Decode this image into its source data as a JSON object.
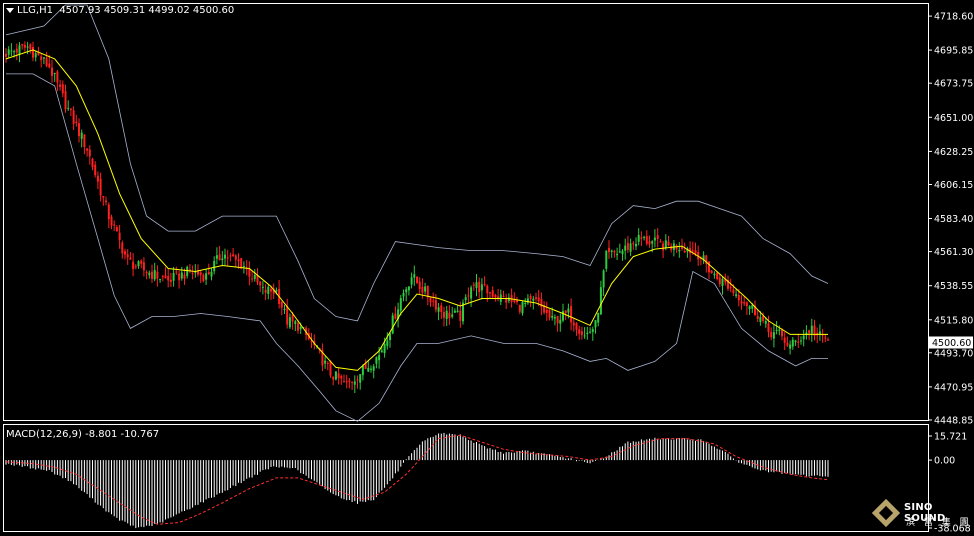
{
  "header": {
    "symbol": "LLG,H1",
    "ohlc": "4507.93 4509.31 4499.02 4500.60"
  },
  "macd": {
    "label": "MACD(12,26,9) -8.801 -10.767",
    "axis_labels": [
      "15.721",
      "0.00",
      "-38.068"
    ]
  },
  "logo": {
    "en": "SINO SOUND",
    "cn": "滨 富 集 團"
  },
  "colors": {
    "background": "#000000",
    "up_candle": "#2ecc40",
    "down_candle": "#ff2020",
    "ma_line": "#ffff00",
    "bands": "#aab4d2",
    "macd_hist": "#ffffff",
    "macd_signal": "#ff3030",
    "grid_border": "#ffffff",
    "price_tag_bg": "#ffffff"
  },
  "chart_data": [
    {
      "type": "candlestick",
      "title": "LLG,H1",
      "y_ticks": [
        4718.6,
        4695.85,
        4673.75,
        4651.0,
        4628.25,
        4606.15,
        4583.4,
        4561.3,
        4538.55,
        4515.8,
        4493.7,
        4470.95,
        4448.85
      ],
      "y_tick_labels": [
        "4718.60",
        "4695.85",
        "4673.75",
        "4651.00",
        "4628.25",
        "4606.15",
        "4583.40",
        "4561.30",
        "4538.55",
        "4515.80",
        "4493.70",
        "4470.95",
        "4448.85"
      ],
      "ylim": [
        4448.85,
        4726
      ],
      "last_price": "4500.60",
      "indicators": [
        "moving-average",
        "bollinger-bands"
      ],
      "close_path": [
        [
          0,
          4694
        ],
        [
          8,
          4698
        ],
        [
          16,
          4685
        ],
        [
          22,
          4660
        ],
        [
          30,
          4630
        ],
        [
          38,
          4585
        ],
        [
          45,
          4555
        ],
        [
          52,
          4548
        ],
        [
          60,
          4542
        ],
        [
          68,
          4548
        ],
        [
          74,
          4545
        ],
        [
          80,
          4560
        ],
        [
          88,
          4552
        ],
        [
          95,
          4535
        ],
        [
          100,
          4535
        ],
        [
          104,
          4515
        ],
        [
          108,
          4512
        ],
        [
          114,
          4498
        ],
        [
          120,
          4480
        ],
        [
          126,
          4472
        ],
        [
          132,
          4482
        ],
        [
          138,
          4492
        ],
        [
          142,
          4510
        ],
        [
          146,
          4530
        ],
        [
          150,
          4545
        ],
        [
          156,
          4532
        ],
        [
          162,
          4520
        ],
        [
          168,
          4518
        ],
        [
          172,
          4540
        ],
        [
          178,
          4535
        ],
        [
          184,
          4530
        ],
        [
          190,
          4525
        ],
        [
          196,
          4528
        ],
        [
          202,
          4515
        ],
        [
          208,
          4520
        ],
        [
          214,
          4505
        ],
        [
          218,
          4512
        ],
        [
          222,
          4558
        ],
        [
          228,
          4562
        ],
        [
          234,
          4570
        ],
        [
          238,
          4568
        ],
        [
          244,
          4565
        ],
        [
          250,
          4565
        ],
        [
          256,
          4560
        ],
        [
          262,
          4545
        ],
        [
          266,
          4540
        ],
        [
          272,
          4530
        ],
        [
          278,
          4520
        ],
        [
          282,
          4508
        ],
        [
          286,
          4506
        ],
        [
          290,
          4498
        ],
        [
          294,
          4504
        ],
        [
          298,
          4510
        ],
        [
          300,
          4505
        ],
        [
          304,
          4503
        ]
      ],
      "ma_path": [
        [
          0,
          4690
        ],
        [
          10,
          4696
        ],
        [
          18,
          4690
        ],
        [
          26,
          4672
        ],
        [
          34,
          4640
        ],
        [
          42,
          4600
        ],
        [
          50,
          4570
        ],
        [
          60,
          4550
        ],
        [
          70,
          4548
        ],
        [
          80,
          4552
        ],
        [
          90,
          4550
        ],
        [
          98,
          4538
        ],
        [
          106,
          4520
        ],
        [
          114,
          4500
        ],
        [
          122,
          4484
        ],
        [
          130,
          4482
        ],
        [
          138,
          4495
        ],
        [
          146,
          4520
        ],
        [
          152,
          4533
        ],
        [
          160,
          4530
        ],
        [
          168,
          4525
        ],
        [
          176,
          4530
        ],
        [
          186,
          4530
        ],
        [
          196,
          4527
        ],
        [
          206,
          4520
        ],
        [
          216,
          4512
        ],
        [
          224,
          4540
        ],
        [
          232,
          4558
        ],
        [
          240,
          4563
        ],
        [
          250,
          4565
        ],
        [
          258,
          4556
        ],
        [
          266,
          4543
        ],
        [
          274,
          4530
        ],
        [
          282,
          4515
        ],
        [
          290,
          4506
        ],
        [
          298,
          4506
        ],
        [
          304,
          4506
        ]
      ],
      "upper_band": [
        [
          0,
          4706
        ],
        [
          14,
          4712
        ],
        [
          22,
          4726
        ],
        [
          30,
          4726
        ],
        [
          38,
          4690
        ],
        [
          46,
          4620
        ],
        [
          52,
          4585
        ],
        [
          60,
          4575
        ],
        [
          70,
          4575
        ],
        [
          80,
          4585
        ],
        [
          90,
          4585
        ],
        [
          100,
          4585
        ],
        [
          108,
          4555
        ],
        [
          114,
          4530
        ],
        [
          122,
          4518
        ],
        [
          130,
          4515
        ],
        [
          136,
          4540
        ],
        [
          144,
          4568
        ],
        [
          152,
          4566
        ],
        [
          160,
          4564
        ],
        [
          172,
          4562
        ],
        [
          184,
          4562
        ],
        [
          196,
          4560
        ],
        [
          206,
          4558
        ],
        [
          216,
          4552
        ],
        [
          224,
          4580
        ],
        [
          232,
          4592
        ],
        [
          240,
          4590
        ],
        [
          248,
          4595
        ],
        [
          256,
          4595
        ],
        [
          264,
          4590
        ],
        [
          272,
          4585
        ],
        [
          280,
          4570
        ],
        [
          290,
          4560
        ],
        [
          298,
          4545
        ],
        [
          304,
          4540
        ]
      ],
      "lower_band": [
        [
          0,
          4680
        ],
        [
          10,
          4680
        ],
        [
          18,
          4672
        ],
        [
          26,
          4620
        ],
        [
          34,
          4570
        ],
        [
          40,
          4532
        ],
        [
          46,
          4510
        ],
        [
          54,
          4518
        ],
        [
          62,
          4518
        ],
        [
          72,
          4520
        ],
        [
          82,
          4518
        ],
        [
          94,
          4515
        ],
        [
          100,
          4500
        ],
        [
          108,
          4485
        ],
        [
          116,
          4468
        ],
        [
          122,
          4455
        ],
        [
          130,
          4448
        ],
        [
          138,
          4460
        ],
        [
          146,
          4485
        ],
        [
          152,
          4500
        ],
        [
          160,
          4500
        ],
        [
          172,
          4505
        ],
        [
          184,
          4500
        ],
        [
          196,
          4500
        ],
        [
          206,
          4495
        ],
        [
          216,
          4488
        ],
        [
          222,
          4490
        ],
        [
          230,
          4482
        ],
        [
          240,
          4488
        ],
        [
          248,
          4500
        ],
        [
          254,
          4548
        ],
        [
          262,
          4540
        ],
        [
          272,
          4510
        ],
        [
          282,
          4495
        ],
        [
          292,
          4485
        ],
        [
          298,
          4490
        ],
        [
          304,
          4490
        ]
      ]
    },
    {
      "type": "macd",
      "title": "MACD(12,26,9)",
      "macd_value": -8.801,
      "signal_value": -10.767,
      "ylim": [
        -38.068,
        15.721
      ],
      "hist_path": [
        [
          0,
          -2
        ],
        [
          8,
          -4
        ],
        [
          16,
          -6
        ],
        [
          24,
          -12
        ],
        [
          32,
          -22
        ],
        [
          40,
          -32
        ],
        [
          48,
          -38
        ],
        [
          56,
          -36
        ],
        [
          64,
          -30
        ],
        [
          72,
          -24
        ],
        [
          80,
          -18
        ],
        [
          90,
          -10
        ],
        [
          98,
          -4
        ],
        [
          106,
          -4
        ],
        [
          114,
          -12
        ],
        [
          122,
          -20
        ],
        [
          130,
          -24
        ],
        [
          136,
          -22
        ],
        [
          142,
          -12
        ],
        [
          148,
          0
        ],
        [
          154,
          10
        ],
        [
          160,
          15
        ],
        [
          168,
          14
        ],
        [
          176,
          8
        ],
        [
          184,
          4
        ],
        [
          192,
          5
        ],
        [
          200,
          3
        ],
        [
          208,
          1
        ],
        [
          216,
          -2
        ],
        [
          222,
          2
        ],
        [
          230,
          10
        ],
        [
          240,
          12
        ],
        [
          250,
          12
        ],
        [
          258,
          11
        ],
        [
          264,
          6
        ],
        [
          272,
          -2
        ],
        [
          280,
          -6
        ],
        [
          290,
          -8
        ],
        [
          298,
          -9
        ],
        [
          304,
          -9
        ]
      ],
      "signal_path": [
        [
          0,
          -1
        ],
        [
          10,
          -2
        ],
        [
          18,
          -4
        ],
        [
          26,
          -8
        ],
        [
          34,
          -16
        ],
        [
          42,
          -24
        ],
        [
          50,
          -32
        ],
        [
          56,
          -36
        ],
        [
          64,
          -35
        ],
        [
          72,
          -30
        ],
        [
          80,
          -24
        ],
        [
          90,
          -16
        ],
        [
          100,
          -10
        ],
        [
          108,
          -10
        ],
        [
          116,
          -14
        ],
        [
          124,
          -18
        ],
        [
          132,
          -22
        ],
        [
          140,
          -18
        ],
        [
          148,
          -8
        ],
        [
          154,
          2
        ],
        [
          160,
          12
        ],
        [
          168,
          14
        ],
        [
          176,
          10
        ],
        [
          184,
          6
        ],
        [
          192,
          4
        ],
        [
          200,
          3
        ],
        [
          208,
          2
        ],
        [
          216,
          0
        ],
        [
          224,
          2
        ],
        [
          232,
          8
        ],
        [
          242,
          12
        ],
        [
          252,
          12
        ],
        [
          262,
          9
        ],
        [
          270,
          2
        ],
        [
          280,
          -4
        ],
        [
          290,
          -8
        ],
        [
          298,
          -10
        ],
        [
          304,
          -11
        ]
      ]
    }
  ]
}
